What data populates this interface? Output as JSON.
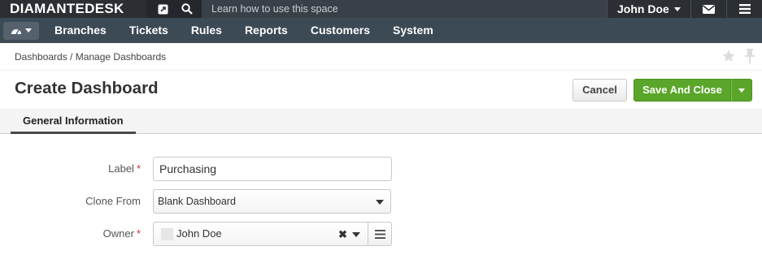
{
  "topbar": {
    "logo": "DIAMANTEDESK",
    "learn_text": "Learn how to use this space",
    "user_name": "John Doe",
    "icons": [
      "external-link-icon",
      "search-icon",
      "mail-icon",
      "menu-icon"
    ]
  },
  "nav": {
    "items": [
      "Branches",
      "Tickets",
      "Rules",
      "Reports",
      "Customers",
      "System"
    ]
  },
  "breadcrumb": "Dashboards / Manage Dashboards",
  "page": {
    "title": "Create Dashboard",
    "cancel_label": "Cancel",
    "save_label": "Save And Close"
  },
  "tabs": {
    "active": "General Information"
  },
  "form": {
    "label_field": {
      "label": "Label",
      "required_mark": "*",
      "value": "Purchasing"
    },
    "clone_from": {
      "label": "Clone From",
      "value": "Blank Dashboard"
    },
    "owner": {
      "label": "Owner",
      "required_mark": "*",
      "value": "John Doe",
      "clear_glyph": "✖"
    }
  },
  "colors": {
    "topbar_bg": "#2b2f33",
    "navbar_bg": "#3c4a56",
    "save_green": "#5aa62a",
    "required_red": "#c9302c"
  }
}
